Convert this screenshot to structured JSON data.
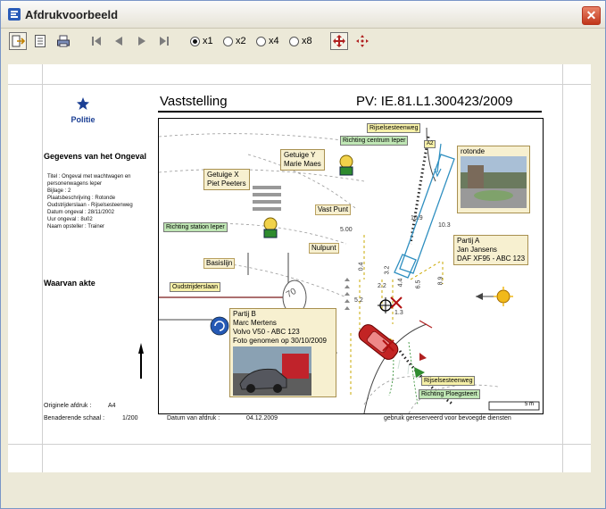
{
  "window": {
    "title": "Afdrukvoorbeeld",
    "close_label": "✕"
  },
  "toolbar": {
    "zoom_options": [
      {
        "label": "x1",
        "selected": true
      },
      {
        "label": "x2",
        "selected": false
      },
      {
        "label": "x4",
        "selected": false
      },
      {
        "label": "x8",
        "selected": false
      }
    ]
  },
  "sheet": {
    "police_label": "Politie",
    "title": "Vaststelling",
    "pv": "PV: IE.81.L1.300423/2009",
    "section_incident": "Gegevens van het Ongeval",
    "details": [
      "Titel : Ongeval met wachtwagen en",
      "personenwagens Ieper",
      "Bijlage : 2",
      "Plaatsbeschrijving : Rotonde",
      "Oudstrijderslaan - Rijselsesteenweg",
      "Datum ongeval : 28/11/2002",
      "Uur ongeval : 8u02",
      "Naam opsteller : Trainer"
    ],
    "section_akte": "Waarvan akte",
    "original_print_label": "Originele afdruk :",
    "original_print_value": "A4",
    "scale_label": "Benaderende schaal :",
    "scale_value": "1/200",
    "print_date_label": "Datum van afdruk :",
    "print_date_value": "04.12.2009",
    "usage_note": "gebruik gereserveerd voor bevoegde diensten"
  },
  "drawing": {
    "tags": {
      "rijsel_top": "Rijselsesteenweg",
      "centrum": "Richting centrum Ieper",
      "station": "Richting station Ieper",
      "oudstrijders": "Oudstrijderslaan",
      "rijsel_bottom": "Rijselsesteenweg",
      "ploeg": "Richting Ploegsteert"
    },
    "labels": {
      "vast_punt": "Vast Punt",
      "nulpunt": "Nulpunt",
      "basislijn": "Basislijn",
      "rotonde": "rotonde",
      "a2": "A2"
    },
    "witness_y": [
      "Getuige Y",
      "Marie Maes"
    ],
    "witness_x": [
      "Getuige X",
      "Piet Peeters"
    ],
    "party_a": [
      "Partij A",
      "Jan Jansens",
      "DAF XF95 - ABC 123"
    ],
    "party_b": [
      "Partij B",
      "Marc Mertens",
      "Volvo V50 - ABC 123",
      "Foto genomen op 30/10/2009"
    ],
    "measures": {
      "m500": "5.00",
      "m04": "0.4",
      "m52": "5.2",
      "m32": "3.2",
      "m22": "2.2",
      "m44": "4.4",
      "m65": "6.5",
      "m89": "8.9",
      "m109": "10.9",
      "m103": "10.3",
      "m13": "1.3"
    },
    "speed_sign": "70",
    "scale_bar": "5 m"
  }
}
